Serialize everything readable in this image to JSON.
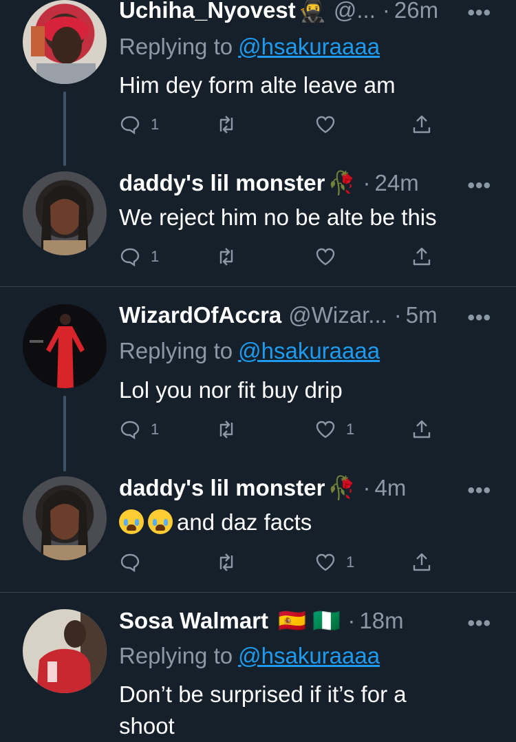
{
  "tweets": [
    {
      "name": "Uchiha_Nyovest",
      "badge": "🥷",
      "handle": "@...",
      "time": "26m",
      "reply_label": "Replying to",
      "reply_mention": "@hsakuraaaa",
      "text": "Him dey form alte leave am",
      "reply_count": "1",
      "retweet_count": "",
      "like_count": ""
    },
    {
      "name": "daddy's lil monster",
      "badge": "🥀",
      "time": "24m",
      "text": "We reject him no be alte be this",
      "reply_count": "1",
      "retweet_count": "",
      "like_count": ""
    },
    {
      "name": "WizardOfAccra",
      "handle": "@Wizar...",
      "time": "5m",
      "reply_label": "Replying to",
      "reply_mention": "@hsakuraaaa",
      "text": "Lol you nor fit buy drip",
      "reply_count": "1",
      "retweet_count": "",
      "like_count": "1"
    },
    {
      "name": "daddy's lil monster",
      "badge": "🥀",
      "time": "4m",
      "emoji": "😭😭",
      "text": "and daz facts",
      "reply_count": "",
      "retweet_count": "",
      "like_count": "1"
    },
    {
      "name": "Sosa Walmart",
      "flags": "🇪🇸 🇳🇬",
      "time": "18m",
      "reply_label": "Replying to",
      "reply_mention": "@hsakuraaaa",
      "text_line1": "Don’t be surprised if it’s for a",
      "text_line2": "shoot"
    }
  ],
  "ui": {
    "more": "•••",
    "dot": "·"
  },
  "colors": {
    "background": "#15202b",
    "secondary_text": "#8b98a5",
    "link": "#1d9bf0",
    "thread_line": "#3d5466",
    "divider": "#38444d"
  }
}
